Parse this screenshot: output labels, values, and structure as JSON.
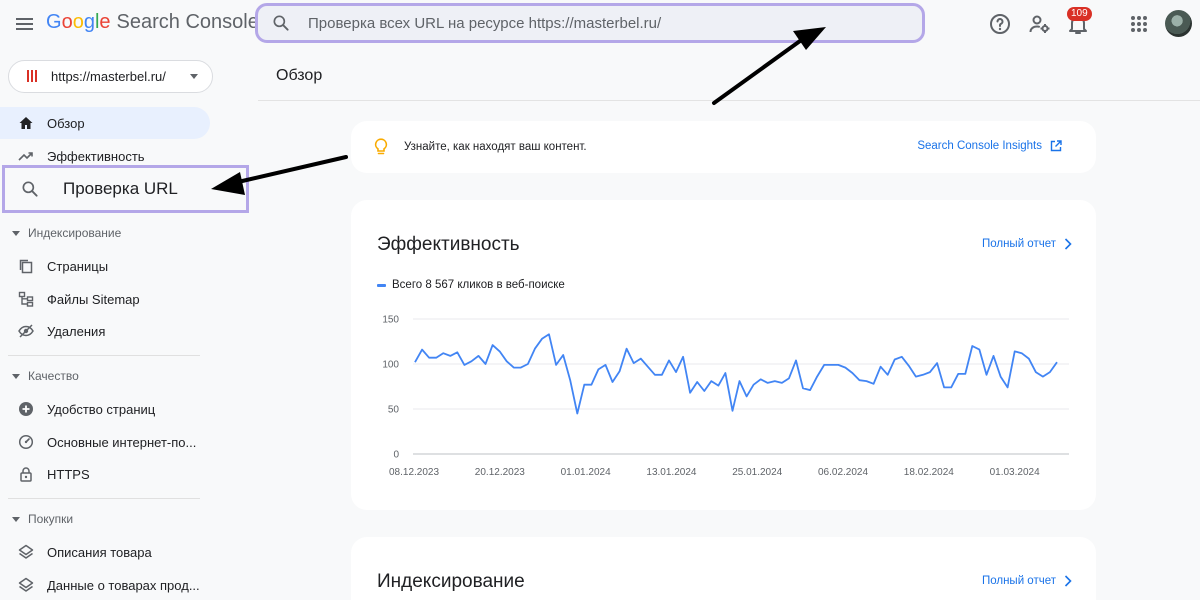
{
  "header": {
    "logo": {
      "g1": "G",
      "g2": "o",
      "g3": "o",
      "g4": "g",
      "g5": "l",
      "g6": "e",
      "product": "Search Console"
    },
    "search_placeholder": "Проверка всех URL на ресурсе https://masterbel.ru/",
    "notification_count": "109",
    "icons": [
      "menu-icon",
      "search-icon",
      "help-icon",
      "manage-users-icon",
      "bell-icon",
      "apps-grid-icon",
      "avatar"
    ]
  },
  "sidebar": {
    "property": "https://masterbel.ru/",
    "top_items": [
      {
        "label": "Обзор",
        "icon": "home-icon"
      },
      {
        "label": "Эффективность",
        "icon": "trending-up-icon"
      },
      {
        "label": "Проверка URL",
        "icon": "search-icon"
      }
    ],
    "sections": [
      {
        "title": "Индексирование",
        "items": [
          "Страницы",
          "Файлы Sitemap",
          "Удаления"
        ]
      },
      {
        "title": "Качество",
        "items": [
          "Удобство страниц",
          "Основные интернет-по...",
          "HTTPS"
        ]
      },
      {
        "title": "Покупки",
        "items": [
          "Описания товара",
          "Данные о товарах прод..."
        ]
      }
    ]
  },
  "main": {
    "title": "Обзор",
    "insight": {
      "text": "Узнайте, как находят ваш контент.",
      "link": "Search Console Insights"
    },
    "performance": {
      "title": "Эффективность",
      "full_report": "Полный отчет"
    },
    "indexing": {
      "title": "Индексирование",
      "full_report": "Полный отчет"
    }
  },
  "colors": {
    "accent": "#1a73e8",
    "line": "#4285f4",
    "highlight": "#b4a7e8",
    "active_bg": "#e8f0fe"
  },
  "chart_data": {
    "type": "line",
    "series": [
      {
        "name": "Всего 8 567 кликов в веб-поиске",
        "values": [
          102,
          116,
          107,
          107,
          112,
          109,
          113,
          99,
          103,
          109,
          100,
          121,
          114,
          103,
          96,
          96,
          100,
          117,
          128,
          133,
          99,
          110,
          82,
          45,
          77,
          77,
          94,
          99,
          80,
          92,
          117,
          101,
          106,
          97,
          88,
          88,
          104,
          91,
          108,
          68,
          80,
          70,
          81,
          76,
          90,
          48,
          81,
          64,
          77,
          83,
          79,
          81,
          79,
          84,
          104,
          73,
          71,
          86,
          99,
          99,
          99,
          96,
          90,
          82,
          81,
          78,
          97,
          88,
          105,
          108,
          98,
          86,
          88,
          91,
          101,
          74,
          74,
          89,
          89,
          120,
          116,
          88,
          109,
          86,
          74,
          114,
          112,
          106,
          91,
          86,
          91,
          102
        ]
      }
    ],
    "x_ticks": [
      "08.12.2023",
      "20.12.2023",
      "01.01.2024",
      "13.01.2024",
      "25.01.2024",
      "06.02.2024",
      "18.02.2024",
      "01.03.2024"
    ],
    "y_ticks": [
      0,
      50,
      100,
      150
    ],
    "ylim": [
      0,
      150
    ],
    "grid": true,
    "legend": "top-left"
  }
}
